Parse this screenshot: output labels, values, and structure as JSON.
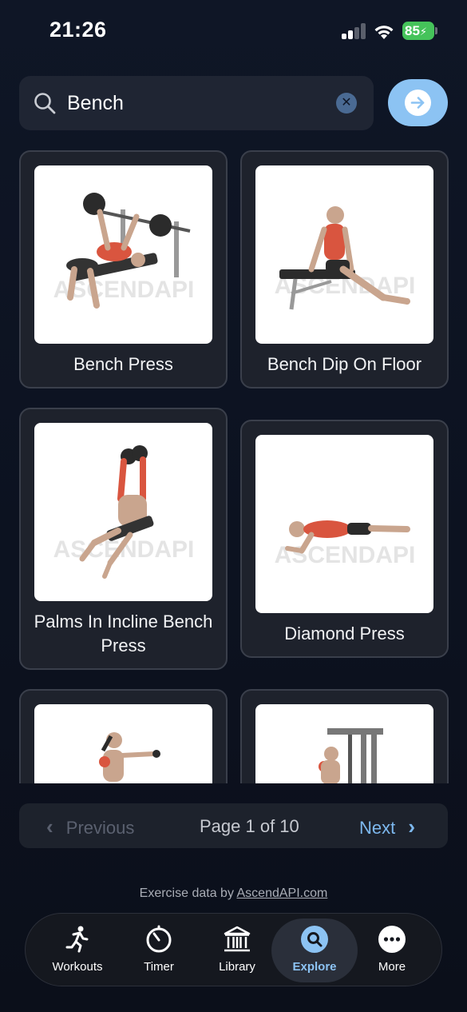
{
  "status_bar": {
    "time": "21:26",
    "battery": "85"
  },
  "search": {
    "value": "Bench",
    "clear_label": "✕"
  },
  "cards": [
    {
      "title": "Bench Press",
      "icon": "bench-press-illustration",
      "watermark": "ASCENDAPI"
    },
    {
      "title": "Bench Dip On Floor",
      "icon": "bench-dip-illustration",
      "watermark": "ASCENDAPI"
    },
    {
      "title": "Palms In Incline Bench Press",
      "icon": "incline-press-illustration",
      "watermark": "ASCENDAPI"
    },
    {
      "title": "Diamond Press",
      "icon": "diamond-press-illustration",
      "watermark": "ASCENDAPI"
    },
    {
      "title": "",
      "icon": "boxing-illustration",
      "watermark": ""
    },
    {
      "title": "",
      "icon": "machine-illustration",
      "watermark": ""
    }
  ],
  "pagination": {
    "previous": "Previous",
    "page": "Page 1 of 10",
    "next": "Next",
    "prev_chevron": "‹",
    "next_chevron": "›"
  },
  "credit": {
    "prefix": "Exercise data by ",
    "link": "AscendAPI.com"
  },
  "tabs": [
    {
      "label": "Workouts",
      "icon": "running-person-icon"
    },
    {
      "label": "Timer",
      "icon": "timer-icon"
    },
    {
      "label": "Library",
      "icon": "library-icon"
    },
    {
      "label": "Explore",
      "icon": "search-icon",
      "active": true
    },
    {
      "label": "More",
      "icon": "more-icon"
    }
  ],
  "colors": {
    "accent": "#8cc3f3",
    "background": "#0d1322",
    "card": "#1e222c",
    "muscle": "#d9553f"
  }
}
